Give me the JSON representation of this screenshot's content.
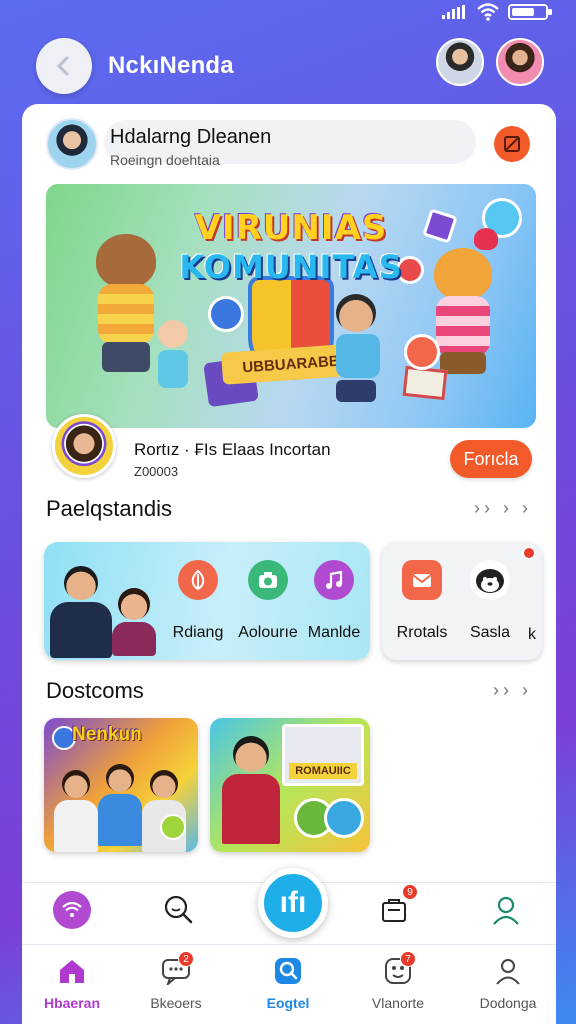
{
  "app": {
    "title": "NckıNenda"
  },
  "status_bar": {
    "battery_level": 0.7,
    "icons": [
      "signal-icon",
      "wifi-icon",
      "battery-icon"
    ]
  },
  "profile": {
    "name": "Hdalarng Dleanen",
    "subtitle": "Roeingn doehtaia"
  },
  "banner": {
    "title_line1": "VIRUNIAS",
    "title_line2": "KOMUNITAS",
    "ribbon_text": "UBBUARABB"
  },
  "promo": {
    "name": "Rortız · ₣Is Elaas Incortan",
    "subtitle": "Z00003",
    "button_label": "Forıcla"
  },
  "sections": {
    "categories": {
      "title": "Paelqstandis",
      "more": "›› › ›"
    },
    "posts": {
      "title": "Dostcoms",
      "more": "›› ›"
    }
  },
  "categories": {
    "card1": [
      {
        "label": "Rdiang",
        "icon": "leaf-icon",
        "color": "#f2674a"
      },
      {
        "label": "Aolourıe",
        "icon": "camera-icon",
        "color": "#3ab87a"
      },
      {
        "label": "Manlde",
        "icon": "music-icon",
        "color": "#b04ad0"
      }
    ],
    "card2": [
      {
        "label": "Rrotals",
        "icon": "mail-icon",
        "color": "#f2674a"
      },
      {
        "label": "Sasla",
        "icon": "dog-icon",
        "color": "#333333"
      }
    ],
    "card2_overflow": "k"
  },
  "posts": [
    {
      "label": "Nenkun"
    },
    {
      "label": "ROMAUIIC"
    }
  ],
  "quick_actions": {
    "center_label": "ıfı",
    "bag_badge": "9"
  },
  "bottom_nav": [
    {
      "label": "Hbaeran",
      "icon": "home-icon",
      "badge": ""
    },
    {
      "label": "Bkeoers",
      "icon": "chat-icon",
      "badge": "2"
    },
    {
      "label": "Eogtel",
      "icon": "search-icon",
      "badge": ""
    },
    {
      "label": "Vlanorte",
      "icon": "game-icon",
      "badge": "7"
    },
    {
      "label": "Dodonga",
      "icon": "profile-icon",
      "badge": ""
    }
  ],
  "colors": {
    "accent": "#f25a2a",
    "primary_blue": "#1eaee8",
    "active_nav": "#b03ad0"
  }
}
